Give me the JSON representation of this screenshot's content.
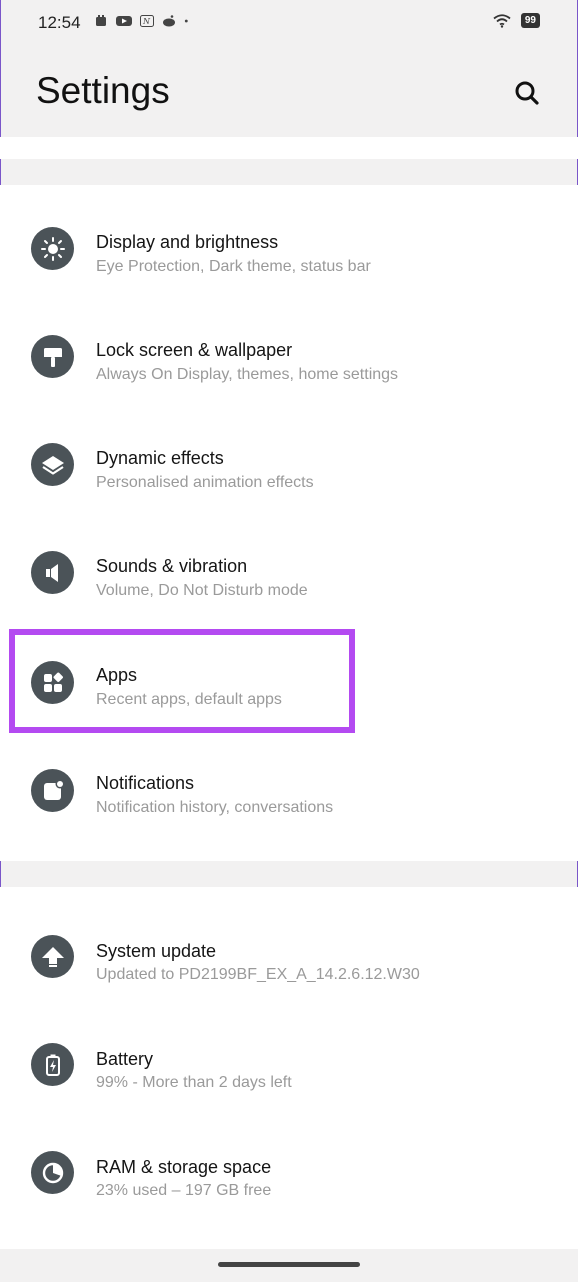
{
  "status_bar": {
    "time": "12:54",
    "battery": "99",
    "notification_icons": [
      "calendar-icon",
      "youtube-icon",
      "app-icon",
      "reddit-icon",
      "dot-icon"
    ]
  },
  "header": {
    "title": "Settings",
    "search_icon": "search-icon"
  },
  "groups": [
    {
      "items": [
        {
          "id": "display",
          "icon": "brightness-icon",
          "label": "Display and brightness",
          "subtitle": "Eye Protection, Dark theme, status bar"
        },
        {
          "id": "lockscreen",
          "icon": "paint-roller-icon",
          "label": "Lock screen & wallpaper",
          "subtitle": "Always On Display, themes, home settings"
        },
        {
          "id": "dynamic",
          "icon": "layers-icon",
          "label": "Dynamic effects",
          "subtitle": "Personalised animation effects"
        },
        {
          "id": "sounds",
          "icon": "speaker-icon",
          "label": "Sounds & vibration",
          "subtitle": "Volume, Do Not Disturb mode"
        },
        {
          "id": "apps",
          "icon": "apps-icon",
          "label": "Apps",
          "subtitle": "Recent apps, default apps"
        },
        {
          "id": "notifications",
          "icon": "notification-icon",
          "label": "Notifications",
          "subtitle": "Notification history, conversations"
        }
      ]
    },
    {
      "items": [
        {
          "id": "system-update",
          "icon": "update-arrow-icon",
          "label": "System update",
          "subtitle": "Updated to PD2199BF_EX_A_14.2.6.12.W30"
        },
        {
          "id": "battery",
          "icon": "battery-icon",
          "label": "Battery",
          "subtitle": "99% - More than 2 days left"
        },
        {
          "id": "storage",
          "icon": "pie-chart-icon",
          "label": "RAM & storage space",
          "subtitle": "23% used – 197 GB free"
        }
      ]
    }
  ],
  "highlight": {
    "target": "apps",
    "color": "#b44af1"
  },
  "colors": {
    "icon_bg": "#4b5358",
    "background": "#f2f1f1",
    "card": "#ffffff",
    "subtitle": "#9a9a9a"
  }
}
